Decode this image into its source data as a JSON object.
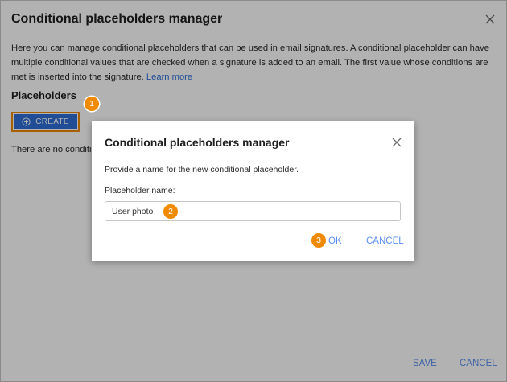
{
  "main": {
    "title": "Conditional placeholders manager",
    "description": "Here you can manage conditional placeholders that can be used in email signatures. A conditional placeholder can have multiple conditional values that are checked when a signature is added to an email. The first value whose conditions are met is inserted into the signature.",
    "learn_more": "Learn more",
    "section_title": "Placeholders",
    "create_label": "CREATE",
    "empty_text": "There are no conditional placeholders",
    "save_label": "SAVE",
    "cancel_label": "CANCEL"
  },
  "dialog": {
    "title": "Conditional placeholders manager",
    "description": "Provide a name for the new conditional placeholder.",
    "field_label": "Placeholder name:",
    "field_value": "User photo",
    "ok_label": "OK",
    "cancel_label": "CANCEL"
  },
  "badges": [
    "1",
    "2",
    "3"
  ],
  "colors": {
    "accent": "#2f6fd6",
    "link": "#5b8ff0",
    "badge": "#f08a00"
  },
  "icons": {
    "close": "close-icon",
    "plus": "plus-circle-icon"
  }
}
